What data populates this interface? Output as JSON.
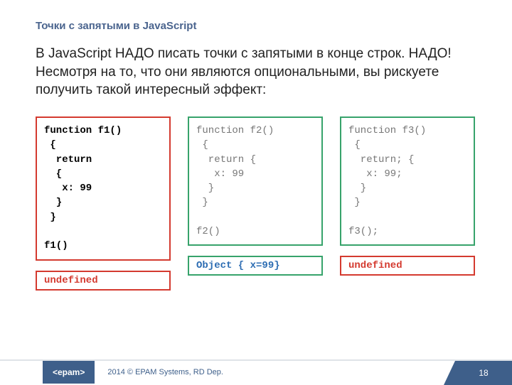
{
  "title": "Точки с запятыми в JavaScript",
  "body": "В JavaScript НАДО писать точки с запятыми в конце строк. НАДО! Несмотря на то, что они являются опциональными, вы рискуете получить такой интересный эффект:",
  "examples": [
    {
      "code": "function f1()\n {\n  return\n  {\n   x: 99\n  }\n }\n\nf1()",
      "result": "undefined",
      "codeStyle": "code-red",
      "resStyle": "res-red"
    },
    {
      "code": "function f2()\n {\n  return {\n   x: 99\n  }\n }\n\nf2()",
      "result": "Object { x=99}",
      "codeStyle": "code-green",
      "resStyle": "res-blue"
    },
    {
      "code": "function f3()\n {\n  return; {\n   x: 99;\n  }\n }\n\nf3();",
      "result": "undefined",
      "codeStyle": "code-green",
      "resStyle": "res-red"
    }
  ],
  "footer": {
    "logo": "<epam>",
    "copyright": "2014 © EPAM Systems, RD Dep.",
    "page": "18"
  }
}
